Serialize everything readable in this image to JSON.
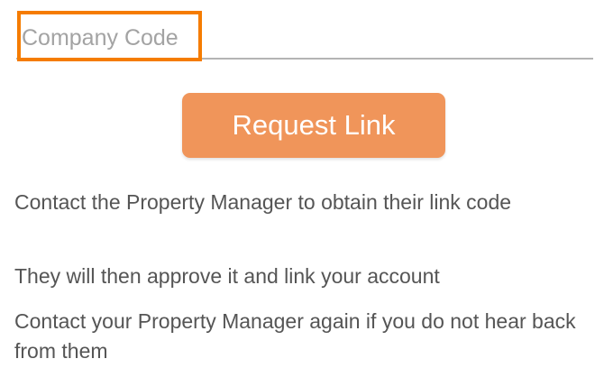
{
  "company_code": {
    "placeholder": "Company Code",
    "value": ""
  },
  "request_button": {
    "label": "Request Link"
  },
  "instructions": [
    "Contact the Property Manager to obtain their link code",
    "They will then approve it and link your account",
    "Contact your Property Manager again if you do not hear back from them"
  ],
  "colors": {
    "accent": "#f0955a",
    "focus_highlight": "#f57c00",
    "text": "#555555",
    "placeholder": "#a3a3a3"
  }
}
